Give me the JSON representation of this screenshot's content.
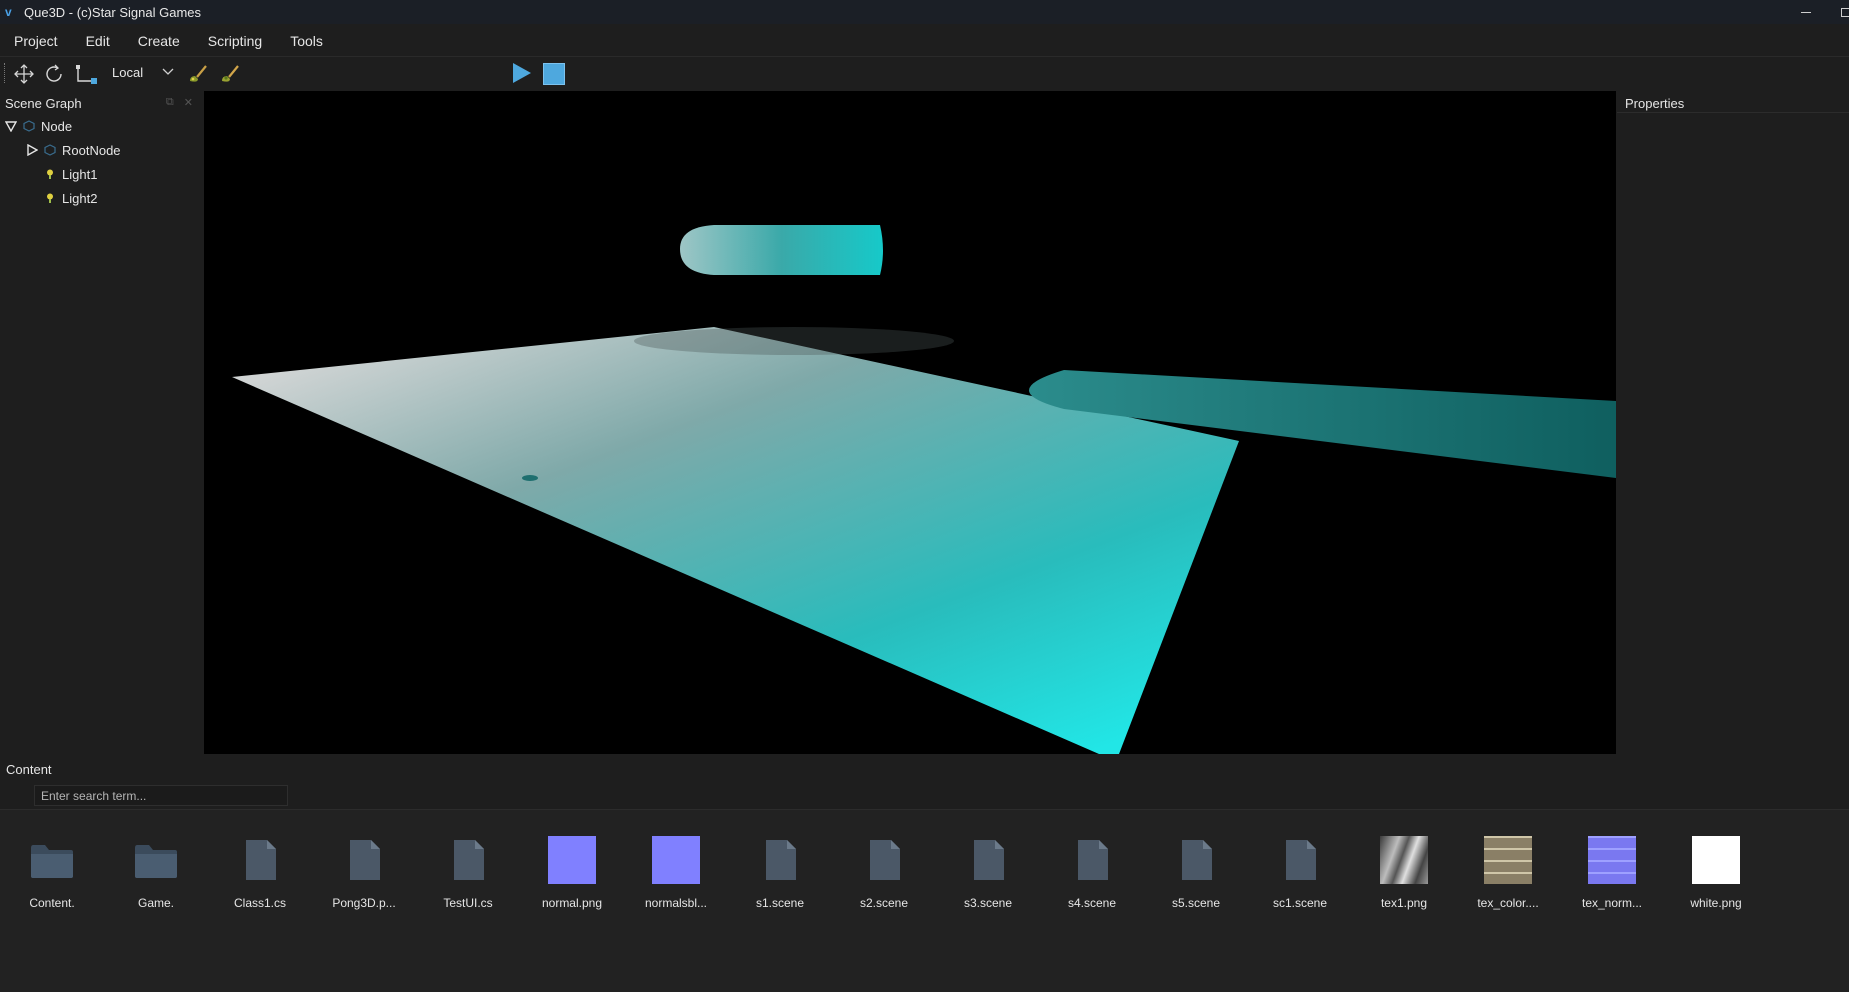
{
  "window": {
    "title": "Que3D - (c)Star Signal Games",
    "logo_glyph": "v"
  },
  "menu": [
    "Project",
    "Edit",
    "Create",
    "Scripting",
    "Tools"
  ],
  "toolbar": {
    "tools": [
      "move-tool",
      "rotate-tool",
      "scale-tool"
    ],
    "space_select": {
      "value": "Local",
      "options": [
        "Local"
      ]
    },
    "brush_tools": [
      "paint-brush-tool",
      "paint-brush-alt-tool"
    ],
    "play_state": [
      "play",
      "stop"
    ]
  },
  "scene_graph": {
    "title": "Scene Graph",
    "nodes": [
      {
        "label": "Node",
        "expanded": true,
        "icon": "node-icon"
      },
      {
        "label": "RootNode",
        "expanded": false,
        "icon": "node-icon"
      },
      {
        "label": "Light1",
        "icon": "light-icon"
      },
      {
        "label": "Light2",
        "icon": "light-icon"
      }
    ]
  },
  "properties": {
    "title": "Properties"
  },
  "content": {
    "title": "Content",
    "search_placeholder": "Enter search term...",
    "items": [
      {
        "label": "Content.",
        "type": "folder"
      },
      {
        "label": "Game.",
        "type": "folder"
      },
      {
        "label": "Class1.cs",
        "type": "file"
      },
      {
        "label": "Pong3D.p...",
        "type": "file"
      },
      {
        "label": "TestUI.cs",
        "type": "file"
      },
      {
        "label": "normal.png",
        "type": "image",
        "color": "#8080ff"
      },
      {
        "label": "normalsbl...",
        "type": "image",
        "color": "#8080ff"
      },
      {
        "label": "s1.scene",
        "type": "file"
      },
      {
        "label": "s2.scene",
        "type": "file"
      },
      {
        "label": "s3.scene",
        "type": "file"
      },
      {
        "label": "s4.scene",
        "type": "file"
      },
      {
        "label": "s5.scene",
        "type": "file"
      },
      {
        "label": "sc1.scene",
        "type": "file"
      },
      {
        "label": "tex1.png",
        "type": "image-metal"
      },
      {
        "label": "tex_color....",
        "type": "image-stone"
      },
      {
        "label": "tex_norm...",
        "type": "image-brick"
      },
      {
        "label": "white.png",
        "type": "image",
        "color": "#ffffff"
      }
    ]
  },
  "colors": {
    "accent": "#4ea8de",
    "scene_cyan": "#22e3e3",
    "panel_bg": "#1e1e1e"
  }
}
